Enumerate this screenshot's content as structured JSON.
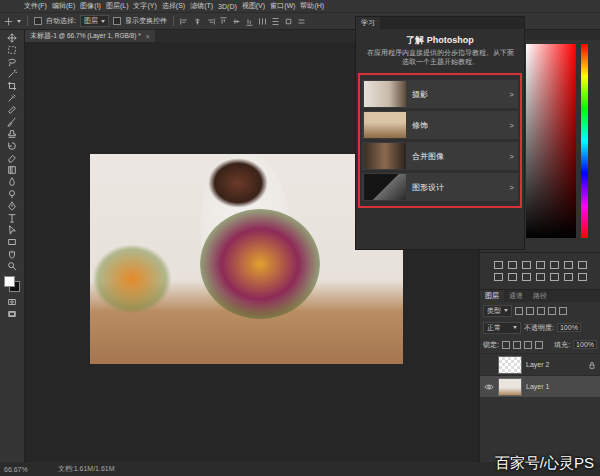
{
  "menu_bar": [
    "文件(F)",
    "编辑(E)",
    "图像(I)",
    "图层(L)",
    "文字(Y)",
    "选择(S)",
    "滤镜(T)",
    "3D(D)",
    "视图(V)",
    "窗口(W)",
    "帮助(H)"
  ],
  "options_bar": {
    "auto_select": {
      "label": "自动选择:",
      "checked": false
    },
    "target": "图层",
    "show_transform": {
      "label": "显示变换控件",
      "checked": false
    }
  },
  "document_tab": {
    "title": "未标题-1 @ 66.7% (Layer 1, RGB/8) *",
    "close": "×"
  },
  "color_swatches": {
    "foreground": "#ffffff",
    "background": "#111111"
  },
  "color_panel": {
    "hue": "#ff0000"
  },
  "learn_panel": {
    "tab": "学习",
    "title": "了解 Photoshop",
    "description": "在应用程序内直接提供的分步指导教程。从下面选取一个主题开始教程。",
    "highlighted": true,
    "highlight_color": "#d7323a",
    "topics": [
      {
        "label": "摄影",
        "arrow": ">",
        "kind": "photo"
      },
      {
        "label": "修饰",
        "arrow": ">",
        "kind": "retouch"
      },
      {
        "label": "合并图像",
        "arrow": ">",
        "kind": "combine"
      },
      {
        "label": "图形设计",
        "arrow": ">",
        "kind": "design"
      }
    ]
  },
  "layers_panel": {
    "tabs": [
      {
        "label": "图层",
        "selected": true
      },
      {
        "label": "通道",
        "selected": false
      },
      {
        "label": "路径",
        "selected": false
      }
    ],
    "filter": "类型",
    "blend_mode": "正常",
    "opacity": {
      "label": "不透明度:",
      "value": "100%"
    },
    "lock_label": "锁定:",
    "fill": {
      "label": "填充:",
      "value": "100%"
    },
    "layers": [
      {
        "name": "Layer 2",
        "visible": false,
        "locked": true,
        "selected": false,
        "kind": "transparent"
      },
      {
        "name": "Layer 1",
        "visible": true,
        "locked": false,
        "selected": true,
        "kind": "photo"
      }
    ]
  },
  "status_bar": {
    "zoom": "66.67%",
    "doc": "文档:1.61M/1.61M"
  },
  "watermark": "百家号/心灵PS"
}
